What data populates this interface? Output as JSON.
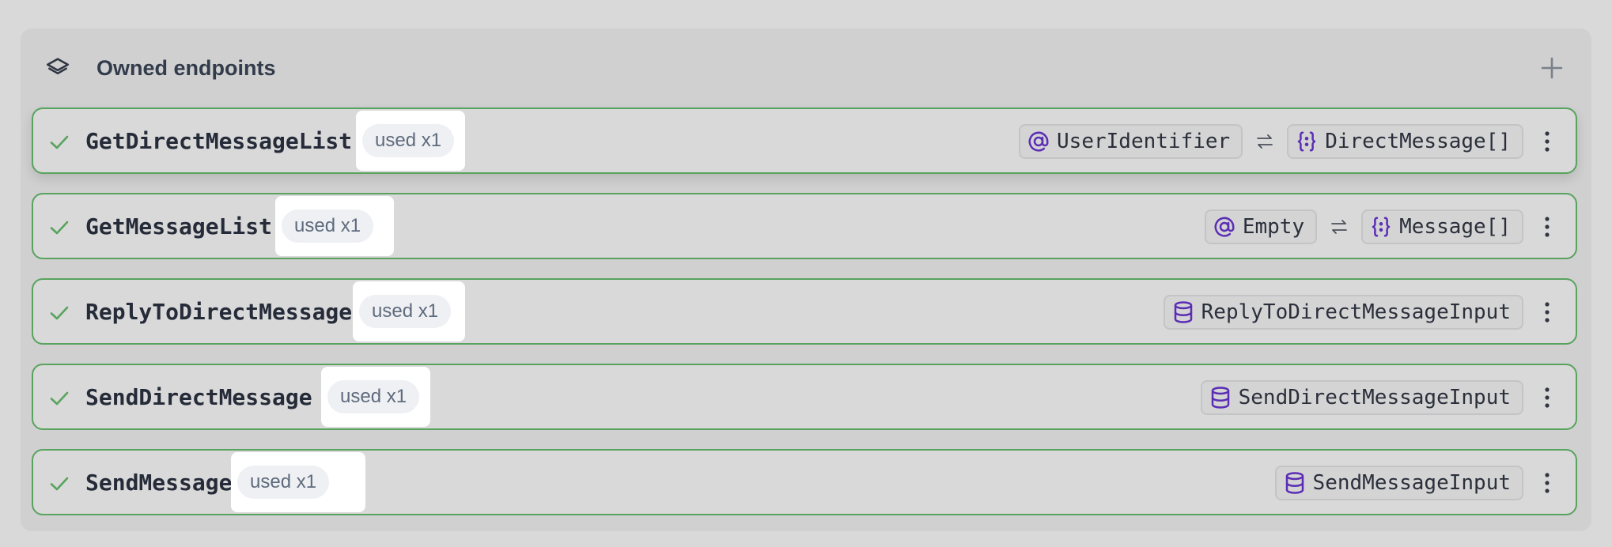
{
  "panel": {
    "title": "Owned endpoints",
    "add_icon": "plus-icon",
    "header_icon": "layers-icon"
  },
  "colors": {
    "success": "#58a35e",
    "type_icon": "#5b2db5",
    "title_text": "#333c4b"
  },
  "endpoints": [
    {
      "name": "GetDirectMessageList",
      "usage": "used x1",
      "input": {
        "kind": "at-icon",
        "label": "UserIdentifier"
      },
      "output": {
        "kind": "braces-icon",
        "label": "DirectMessage[]"
      }
    },
    {
      "name": "GetMessageList",
      "usage": "used x1",
      "input": {
        "kind": "at-icon",
        "label": "Empty"
      },
      "output": {
        "kind": "braces-icon",
        "label": "Message[]"
      }
    },
    {
      "name": "ReplyToDirectMessage",
      "usage": "used x1",
      "input": {
        "kind": "database-icon",
        "label": "ReplyToDirectMessageInput"
      }
    },
    {
      "name": "SendDirectMessage",
      "usage": "used x1",
      "input": {
        "kind": "database-icon",
        "label": "SendDirectMessageInput"
      }
    },
    {
      "name": "SendMessage",
      "usage": "used x1",
      "input": {
        "kind": "database-icon",
        "label": "SendMessageInput"
      }
    }
  ]
}
